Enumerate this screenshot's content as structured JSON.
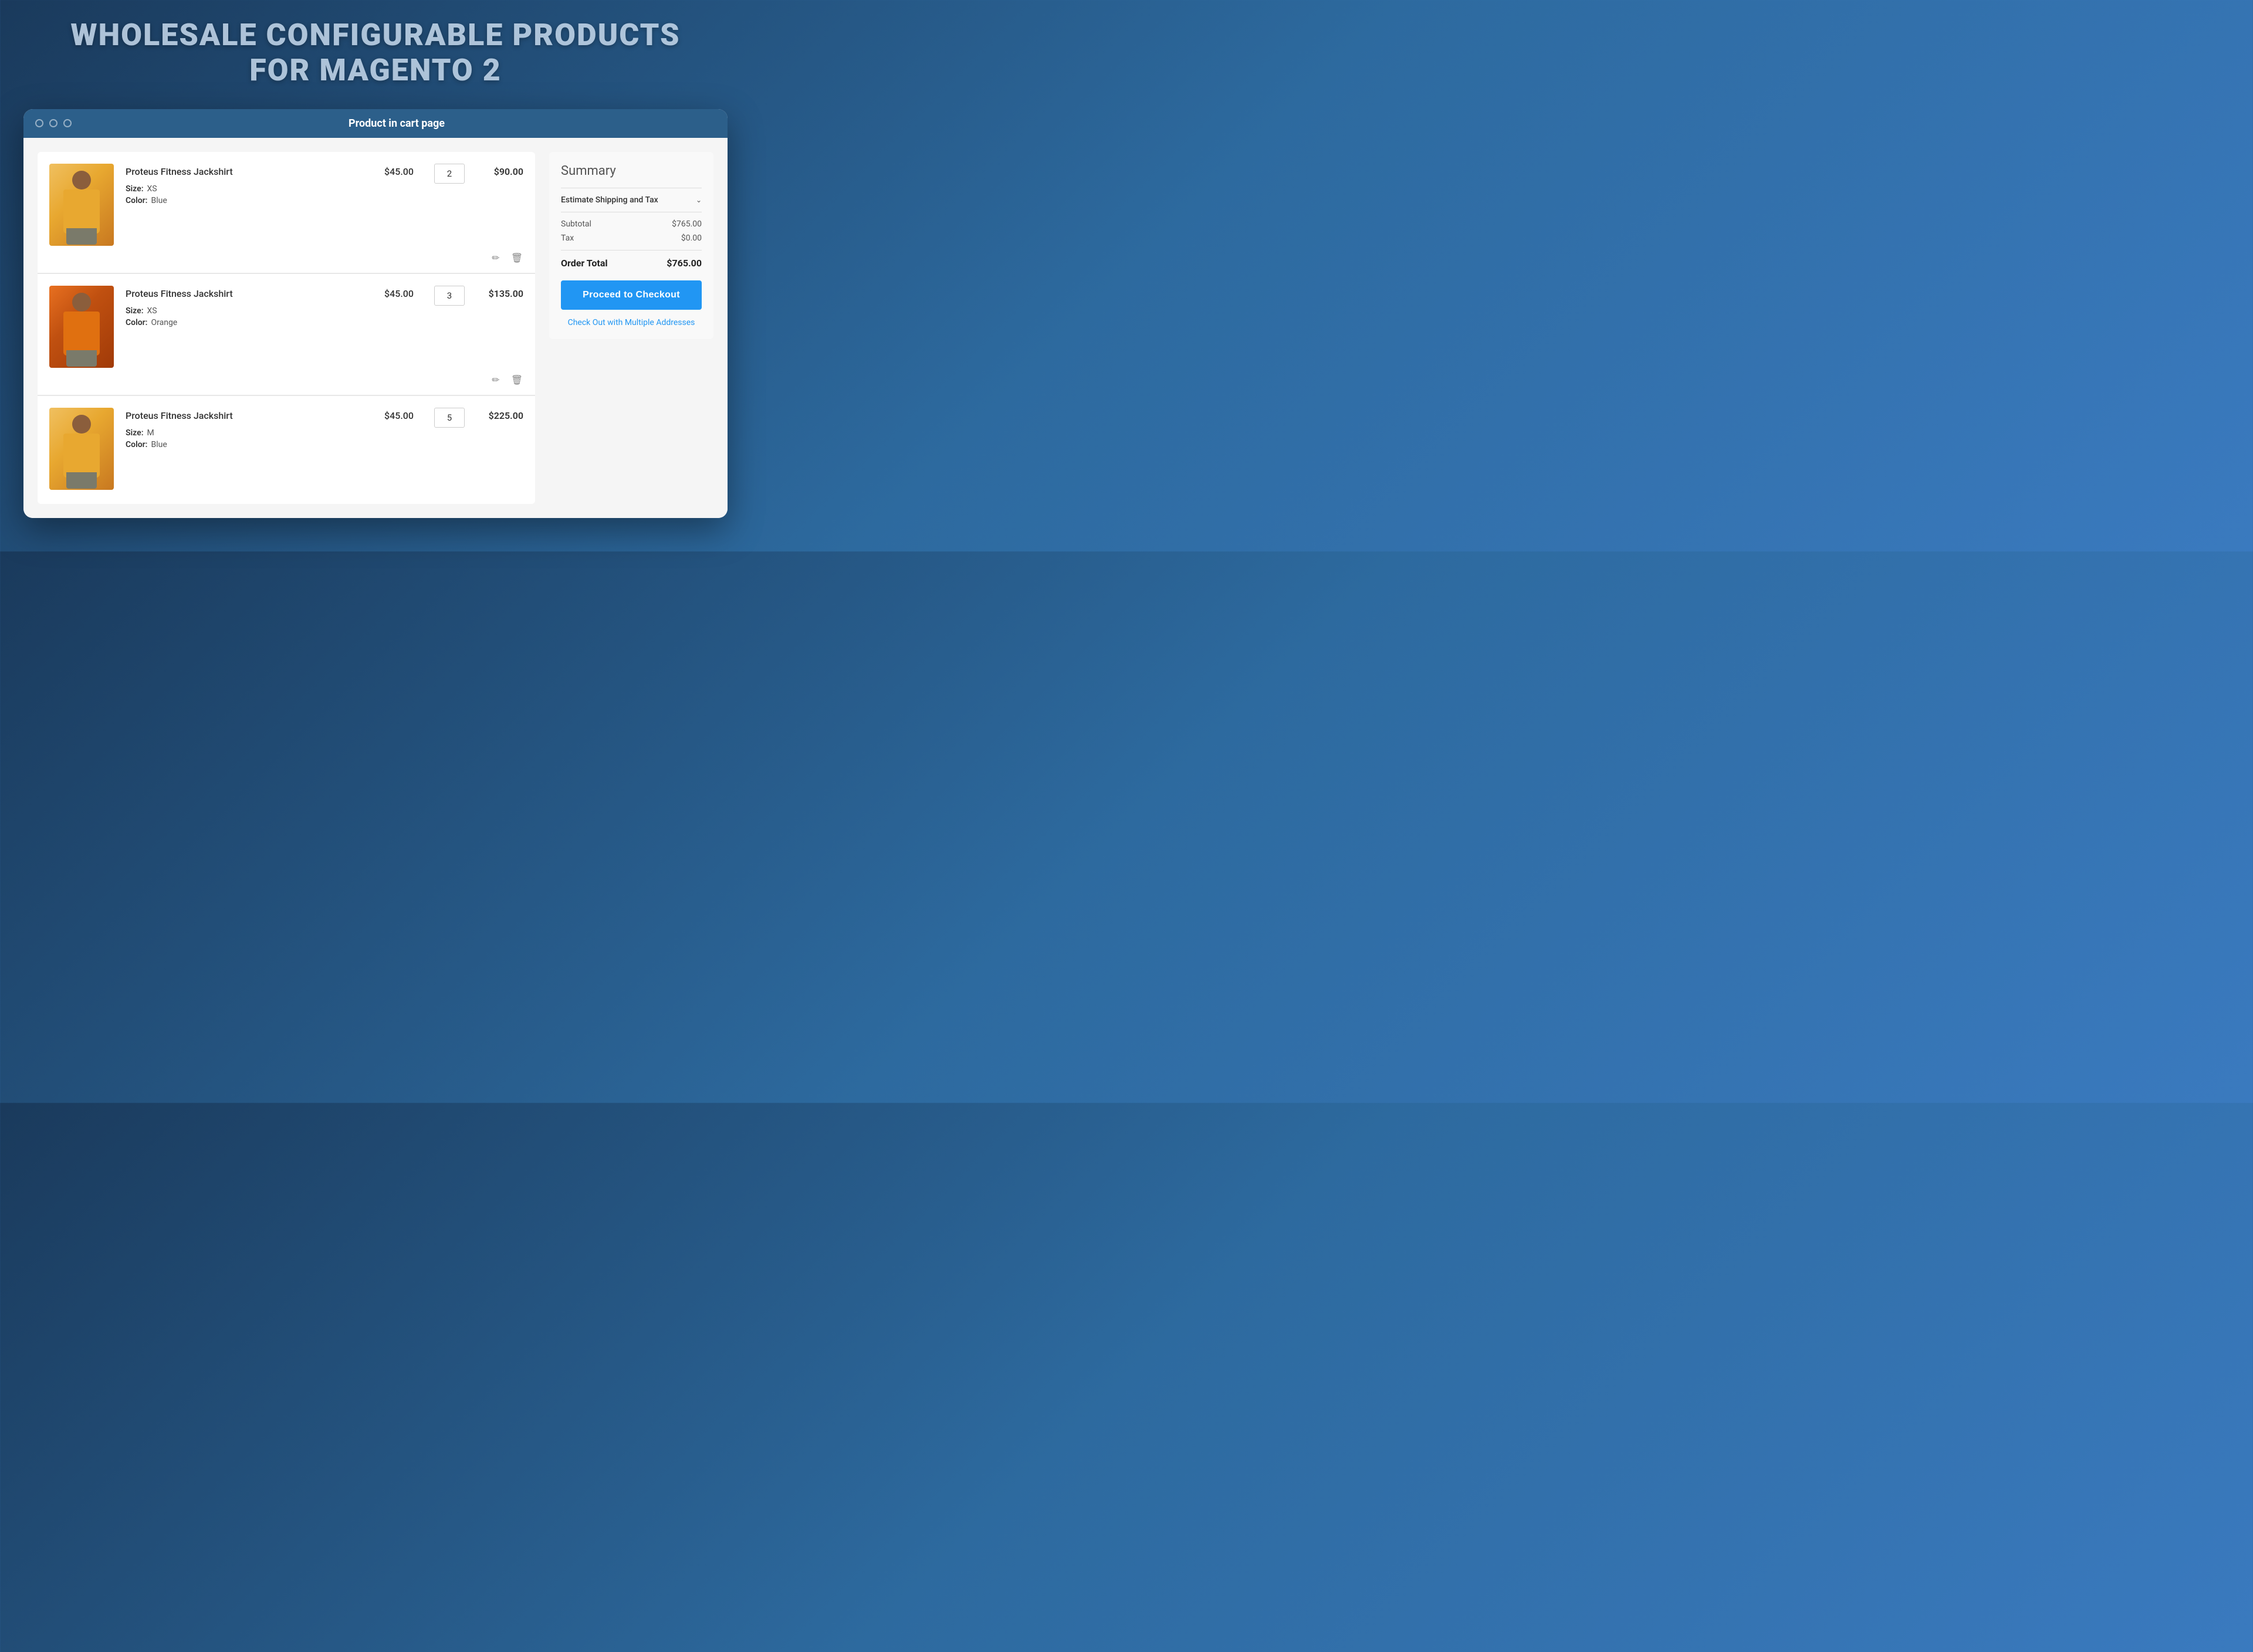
{
  "hero": {
    "title_line1": "WHOLESALE CONFIGURABLE PRODUCTS",
    "title_line2": "FOR MAGENTO 2"
  },
  "browser": {
    "window_title": "Product in cart page",
    "dots": [
      "",
      "",
      ""
    ]
  },
  "cart": {
    "items": [
      {
        "id": 1,
        "name": "Proteus Fitness Jackshirt",
        "price": "$45.00",
        "quantity": "2",
        "total": "$90.00",
        "size_label": "Size:",
        "size_value": "XS",
        "color_label": "Color:",
        "color_value": "Blue",
        "color_type": "blue"
      },
      {
        "id": 2,
        "name": "Proteus Fitness Jackshirt",
        "price": "$45.00",
        "quantity": "3",
        "total": "$135.00",
        "size_label": "Size:",
        "size_value": "XS",
        "color_label": "Color:",
        "color_value": "Orange",
        "color_type": "orange"
      },
      {
        "id": 3,
        "name": "Proteus Fitness Jackshirt",
        "price": "$45.00",
        "quantity": "5",
        "total": "$225.00",
        "size_label": "Size:",
        "size_value": "M",
        "color_label": "Color:",
        "color_value": "Blue",
        "color_type": "blue"
      }
    ]
  },
  "summary": {
    "title": "Summary",
    "shipping_label": "Estimate Shipping and Tax",
    "subtotal_label": "Subtotal",
    "subtotal_value": "$765.00",
    "tax_label": "Tax",
    "tax_value": "$0.00",
    "order_total_label": "Order Total",
    "order_total_value": "$765.00",
    "checkout_button": "Proceed to Checkout",
    "multi_address_link": "Check Out with Multiple Addresses"
  }
}
